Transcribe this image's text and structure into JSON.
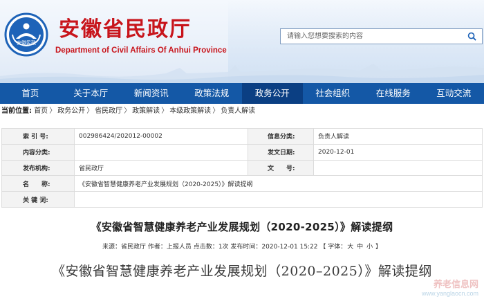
{
  "header": {
    "title": "安徽省民政厅",
    "subtitle": "Department of Civil Affairs Of Anhui Province",
    "logo_text": "安徽民政"
  },
  "search": {
    "placeholder": "请输入您想要搜索的内容",
    "icon": "search-icon"
  },
  "nav": {
    "items": [
      {
        "label": "首页"
      },
      {
        "label": "关于本厅"
      },
      {
        "label": "新闻资讯"
      },
      {
        "label": "政策法规"
      },
      {
        "label": "政务公开"
      },
      {
        "label": "社会组织"
      },
      {
        "label": "在线服务"
      },
      {
        "label": "互动交流"
      }
    ],
    "active_label": "政务公开"
  },
  "breadcrumb": {
    "label": "当前位置:",
    "items": [
      "首页",
      "政务公开",
      "省民政厅",
      "政策解读",
      "本级政策解读",
      "负责人解读"
    ],
    "separator": "〉"
  },
  "info_table": {
    "index_label": "索 引 号:",
    "index_value": "002986424/202012-00002",
    "category_label": "信息分类:",
    "category_value": "负责人解读",
    "content_category_label": "内容分类:",
    "content_category_value": "",
    "publish_date_label": "发文日期:",
    "publish_date_value": "2020-12-01",
    "issuer_label": "发布机构:",
    "issuer_value": "省民政厅",
    "doc_no_label": "文　　号:",
    "doc_no_value": "",
    "name_label": "名　　称:",
    "name_value": "《安徽省智慧健康养老产业发展规划（2020-2025）》解读提纲",
    "keywords_label": "关 键 词:",
    "keywords_value": ""
  },
  "article": {
    "title": "《安徽省智慧健康养老产业发展规划（2020-2025）》解读提纲",
    "meta_source": "来源：省民政厅",
    "meta_author": "作者：上报人员",
    "meta_views": "点击数：1次",
    "meta_time": "发布时间：2020-12-01 15:22",
    "font_label": "【 字体：",
    "font_large": "大",
    "font_medium": "中",
    "font_small": "小",
    "font_end": "】",
    "doc_title": "《安徽省智慧健康养老产业发展规划（2020–2025）》解读提纲"
  },
  "watermark": {
    "cn": "养老信息网",
    "url": "www.yanglaocn.com"
  },
  "colors": {
    "brand_red": "#c8141b",
    "nav_blue": "#1458a6",
    "nav_active": "#0b3f83"
  }
}
